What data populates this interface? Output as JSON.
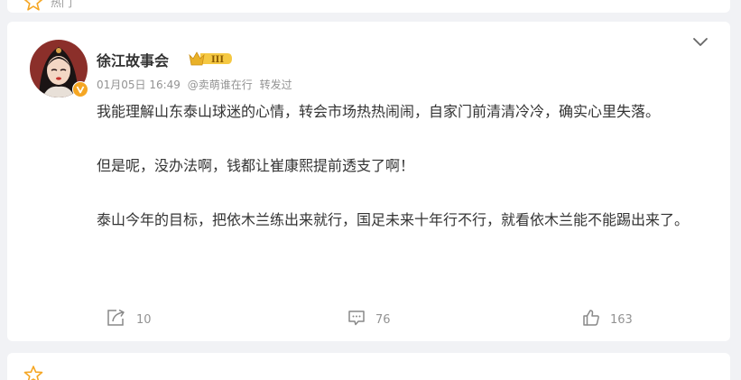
{
  "header": {
    "hot_label": "热门"
  },
  "post": {
    "author": "徐江故事会",
    "user_level": "III",
    "date": "01月05日 16:49",
    "source": "@卖萌谁在行",
    "forward_label": "转发过",
    "paragraphs": [
      "我能理解山东泰山球迷的心情，转会市场热热闹闹，自家门前清清冷冷，确实心里失落。",
      "但是呢，没办法啊，钱都让崔康熙提前透支了啊！",
      "泰山今年的目标，把依木兰练出来就行，国足未来十年行不行，就看依木兰能不能踢出来了。"
    ],
    "actions": {
      "repost_count": "10",
      "comment_count": "76",
      "like_count": "163"
    }
  },
  "colors": {
    "accent_orange": "#f5a623",
    "meta_gray": "#939393",
    "text": "#333333",
    "background": "#f1f2f5"
  },
  "icons": [
    "star-icon",
    "verified-icon",
    "level-badge-icon",
    "chevron-down-icon",
    "repost-icon",
    "comment-icon",
    "like-icon"
  ]
}
